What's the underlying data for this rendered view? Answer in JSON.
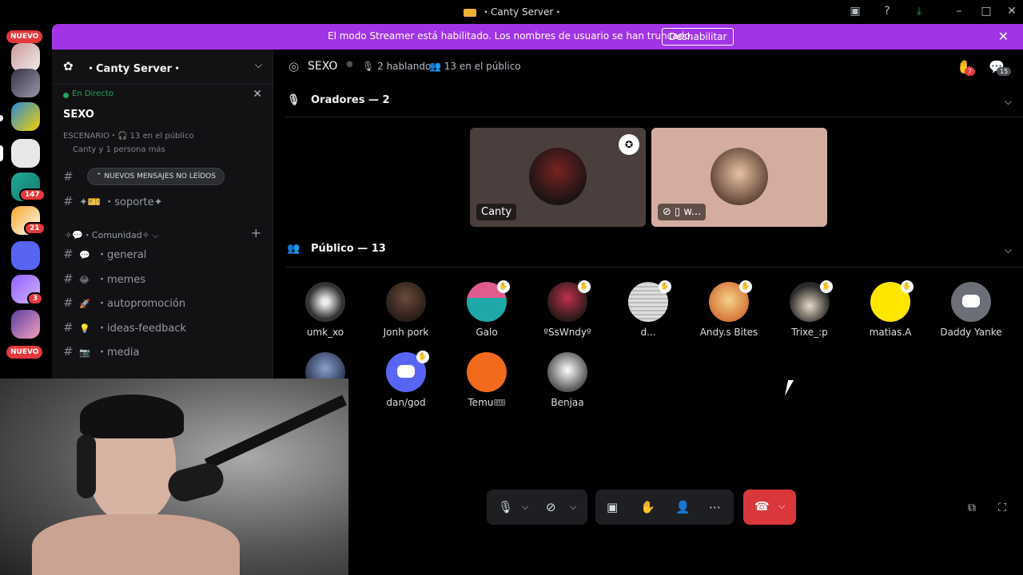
{
  "window": {
    "title": "・Canty Server・"
  },
  "rail": {
    "nuevo_top": "NUEVO",
    "nuevo_bottom": "NUEVO",
    "badges": [
      "147",
      "21",
      "3"
    ]
  },
  "banner": {
    "message": "El modo Streamer está habilitado. Los nombres de usuario se han truncado.",
    "button": "Deshabilitar"
  },
  "sidebar": {
    "server_name": "・Canty Server・",
    "live_status": "En Directo",
    "channel_name": "SEXO",
    "stage_meta": "ESCENARIO・🎧 13 en el público",
    "people": "Canty y 1 persona más",
    "unread_pill": "NUEVOS MENSAJES NO LEÍDOS",
    "category": "✧💬・Comunidad✧",
    "channels": [
      {
        "emoji": "✦🎫",
        "name": "・soporte✦"
      },
      {
        "emoji": "💬",
        "name": "・general"
      },
      {
        "emoji": "😂",
        "name": "・memes"
      },
      {
        "emoji": "🚀",
        "name": "・autopromoción"
      },
      {
        "emoji": "💡",
        "name": "・ideas-feedback"
      },
      {
        "emoji": "📷",
        "name": "・media"
      }
    ]
  },
  "stage": {
    "name": "SEXO",
    "speaking": "2 hablando",
    "audience": "13 en el público",
    "hand_badge": "7",
    "invite_badge": "15",
    "speakers_heading": "Oradores — 2",
    "audience_heading": "Público — 13",
    "speakers": [
      {
        "name": "Canty"
      },
      {
        "name": "w..."
      }
    ],
    "audience_members": [
      {
        "name": "umk_xo"
      },
      {
        "name": "Jonh pork"
      },
      {
        "name": "Galo"
      },
      {
        "name": "ºSsWndyº"
      },
      {
        "name": "d..."
      },
      {
        "name": "Andy.s Bites"
      },
      {
        "name": "Trixe_:p"
      },
      {
        "name": "matias.A"
      },
      {
        "name": "Daddy Yanke"
      },
      {
        "name": ""
      },
      {
        "name": "dan/god"
      },
      {
        "name": "Temu🎟"
      },
      {
        "name": "Benjaa"
      }
    ]
  },
  "colors": {
    "banner": "#a234e8",
    "hangup": "#da373c",
    "live": "#23a55a",
    "badge": "#e5383b"
  }
}
